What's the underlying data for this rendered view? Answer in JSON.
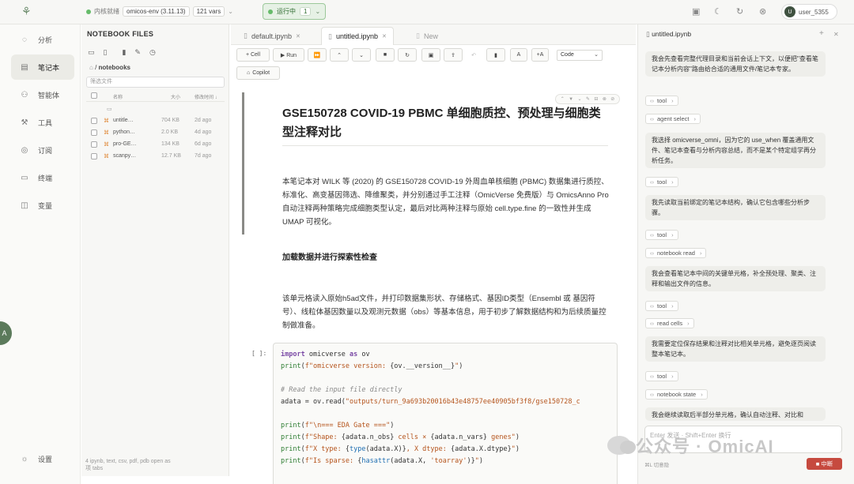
{
  "topbar": {
    "kernel_status": "内核就绪",
    "env": "omicos-env (3.11.13)",
    "vars": "121 vars",
    "run_label": "运行中",
    "run_count": "1",
    "username": "user_5355",
    "avatar_letter": "U"
  },
  "nav": {
    "items": [
      {
        "label": "分析",
        "icon": "chat-icon"
      },
      {
        "label": "笔记本",
        "icon": "notebook-icon",
        "active": true
      },
      {
        "label": "智能体",
        "icon": "agent-icon"
      },
      {
        "label": "工具",
        "icon": "wrench-icon"
      },
      {
        "label": "订阅",
        "icon": "rss-icon"
      },
      {
        "label": "终端",
        "icon": "terminal-icon"
      },
      {
        "label": "变量",
        "icon": "variable-icon"
      }
    ],
    "settings_label": "设置",
    "float_letter": "A"
  },
  "files": {
    "title": "NOTEBOOK FILES",
    "breadcrumb": "notebooks",
    "filter_placeholder": "筛选文件",
    "col_name": "名称",
    "col_size": "大小",
    "col_modified": "修改时间 ↓",
    "rows": [
      {
        "name": "untitle…",
        "size": "704 KB",
        "time": "2d ago"
      },
      {
        "name": "python…",
        "size": "2.0 KB",
        "time": "4d ago"
      },
      {
        "name": "pro-GE…",
        "size": "134 KB",
        "time": "6d ago"
      },
      {
        "name": "scanpy…",
        "size": "12.7 KB",
        "time": "7d ago"
      }
    ],
    "footer_line1": "4   ipynb, text, csv, pdf, pdb open as",
    "footer_line2": "项   tabs"
  },
  "tabs": [
    {
      "label": "default.ipynb"
    },
    {
      "label": "untitled.ipynb",
      "active": true
    },
    {
      "label": "New"
    }
  ],
  "toolbar": {
    "cell": "+ Cell",
    "run": "▶ Run",
    "code_select": "Code",
    "copilot": "Copilot"
  },
  "notebook": {
    "title": "GSE150728 COVID-19 PBMC 单细胞质控、预处理与细胞类型注释对比",
    "intro": "本笔记本对 WILK 等 (2020) 的 GSE150728 COVID-19 外周血单核细胞 (PBMC) 数据集进行质控、标准化、高变基因筛选、降维聚类，并分别通过手工注释（OmicVerse 免费版）与 OmicsAnno Pro 自动注释两种策略完成细胞类型认定，最后对比两种注释与原始 cell.type.fine 的一致性并生成 UMAP 可视化。",
    "section": "加载数据并进行探索性检查",
    "section_desc": "该单元格读入原始h5ad文件，并打印数据集形状、存储格式、基因ID类型（Ensembl 或 基因符号）、线粒体基因数量以及观测元数据（obs）等基本信息，用于初步了解数据结构和为后续质量控制做准备。",
    "prompt": "[ ]:",
    "code_lines": [
      "import omicverse as ov",
      "print(f\"omicverse version: {ov.__version__}\")",
      "",
      "# Read the input file directly",
      "adata = ov.read(\"outputs/turn_9a693b20016b43e48757ee40905bf3f8/gse150728_c",
      "",
      "print(f\"\\n=== EDA Gate ===\")",
      "print(f\"Shape: {adata.n_obs} cells × {adata.n_vars} genes\")",
      "print(f\"X type: {type(adata.X)}, X dtype: {adata.X.dtype}\")",
      "print(f\"Is sparse: {hasattr(adata.X, 'toarray')}\")"
    ]
  },
  "chat": {
    "title": "untitled.ipynb",
    "messages": [
      {
        "type": "bubble",
        "text": "我会先查看完整代理目录和当前会话上下文，以便把\"查看笔记本分析内容\"路由给合适的通用文件/笔记本专家。"
      },
      {
        "type": "pill",
        "text": "tool"
      },
      {
        "type": "pill",
        "text": "agent select"
      },
      {
        "type": "bubble",
        "text": "我选择 omicverse_omni，因为它的 use_when 覆盖通用文件、笔记本查看与分析内容总结，而不是某个特定组学再分析任务。"
      },
      {
        "type": "pill",
        "text": "tool"
      },
      {
        "type": "bubble",
        "text": "我先读取当前绑定的笔记本结构，确认它包含哪些分析步骤。"
      },
      {
        "type": "pill",
        "text": "tool"
      },
      {
        "type": "pill",
        "text": "notebook read"
      },
      {
        "type": "bubble",
        "text": "我会查看笔记本中间的关键单元格，补全预处理、聚类、注释和输出文件的信息。"
      },
      {
        "type": "pill",
        "text": "tool"
      },
      {
        "type": "pill",
        "text": "read cells"
      },
      {
        "type": "bubble",
        "text": "我需要定位保存结果和注释对比相关单元格，避免逐页阅读整本笔记本。"
      },
      {
        "type": "pill",
        "text": "tool"
      },
      {
        "type": "pill",
        "text": "notebook state"
      },
      {
        "type": "bubble",
        "text": "我会继续读取后半部分单元格，确认自动注释、对比和"
      }
    ],
    "input_placeholder": "Enter 发送 · Shift+Enter 换行",
    "hint": "⌘L 切意隐",
    "stop_label": "■ 中断"
  },
  "watermark": "公众号 · OmicAI"
}
